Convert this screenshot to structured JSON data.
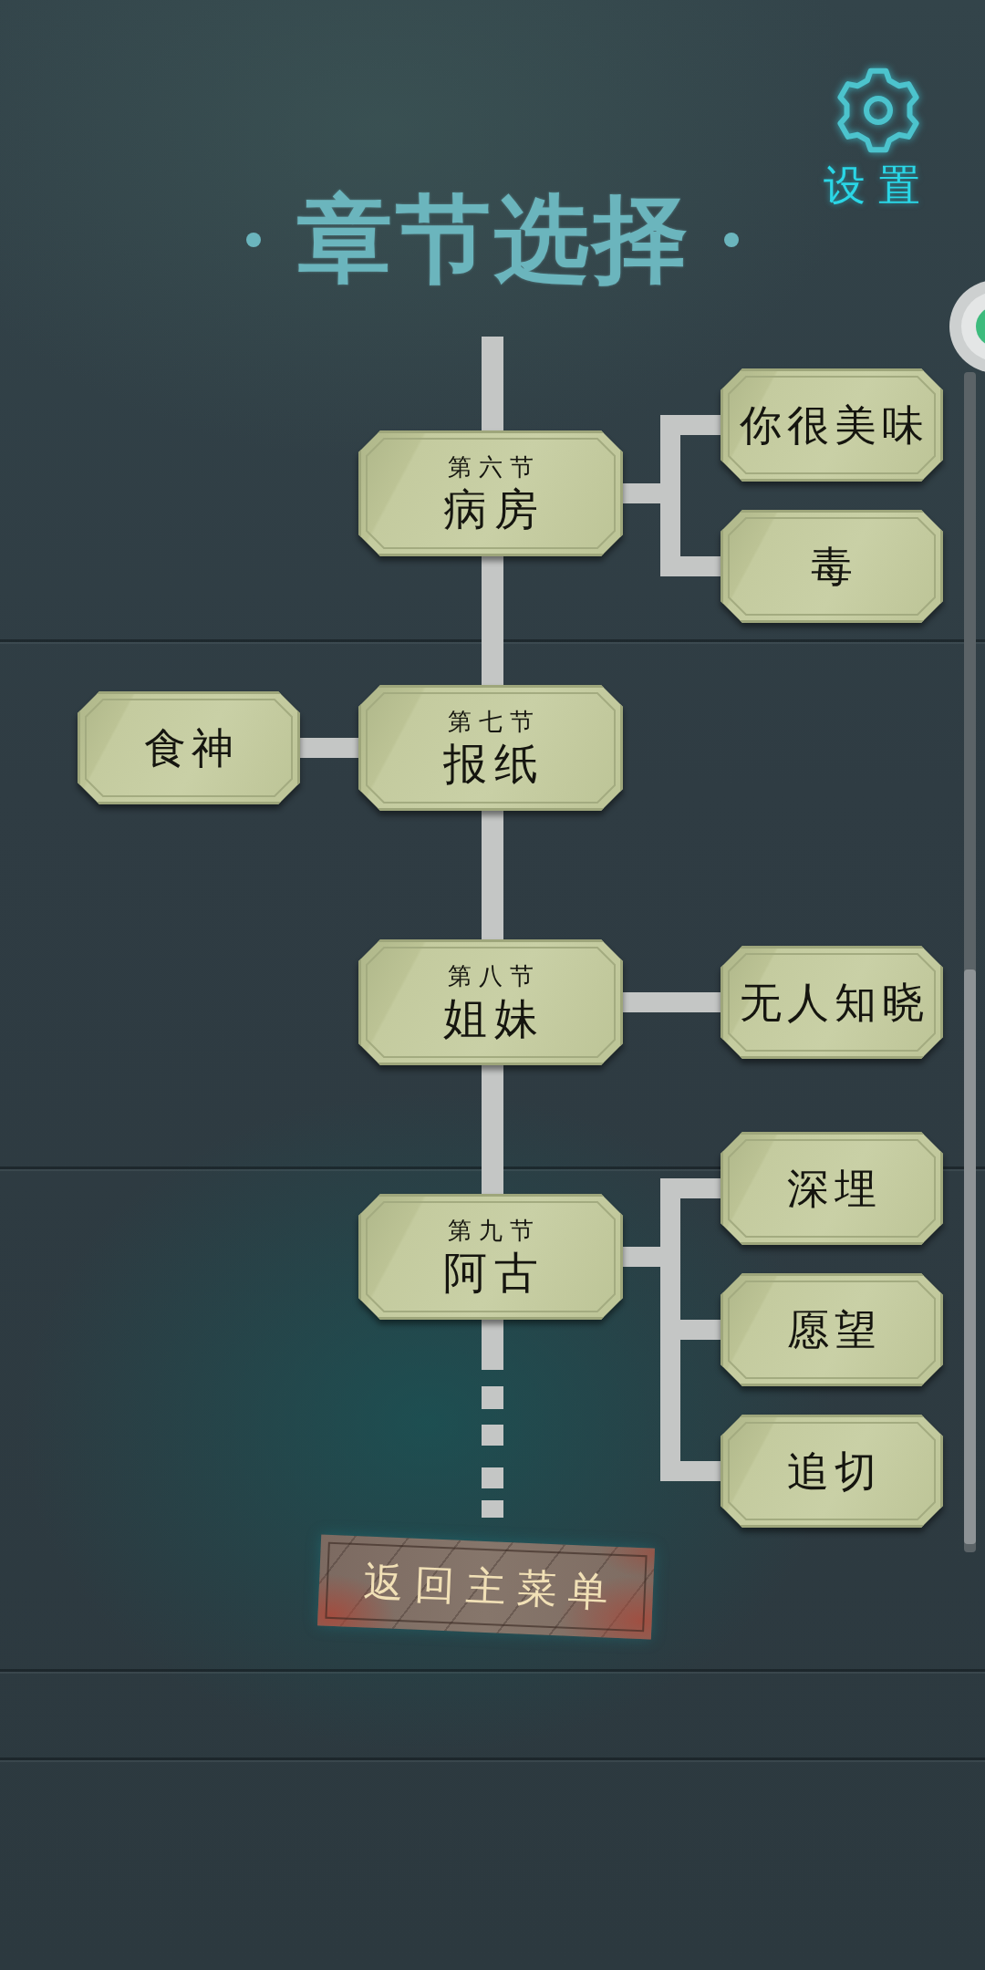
{
  "header": {
    "title": "章节选择",
    "settings_button": {
      "label": "设置"
    }
  },
  "chapters": [
    {
      "number": "第六节",
      "title": "病房",
      "right_branches": [
        {
          "label": "你很美味"
        },
        {
          "label": "毒"
        }
      ]
    },
    {
      "number": "第七节",
      "title": "报纸",
      "left_branches": [
        {
          "label": "食神"
        }
      ]
    },
    {
      "number": "第八节",
      "title": "姐妹",
      "right_branches": [
        {
          "label": "无人知晓"
        }
      ]
    },
    {
      "number": "第九节",
      "title": "阿古",
      "right_branches": [
        {
          "label": "深埋"
        },
        {
          "label": "愿望"
        },
        {
          "label": "追切"
        }
      ]
    }
  ],
  "back_button": {
    "label": "返回主菜单"
  }
}
